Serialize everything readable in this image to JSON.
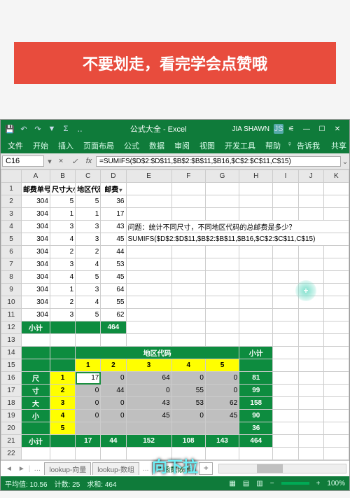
{
  "banner": "不要划走，看完学会点赞哦",
  "caption": "向下拉",
  "titlebar": {
    "title": "公式大全 - Excel",
    "user": "JIA SHAWN",
    "avatar": "JS"
  },
  "ribbon": {
    "tabs": [
      "文件",
      "开始",
      "插入",
      "页面布局",
      "公式",
      "数据",
      "审阅",
      "视图",
      "开发工具",
      "帮助"
    ],
    "tellme": "告诉我",
    "share": "共享"
  },
  "namebox": "C16",
  "formula": "=SUMIFS($D$2:$D$11,$B$2:$B$11,$B16,$C$2:$C$11,C$15)",
  "cols": [
    "",
    "A",
    "B",
    "C",
    "D",
    "E",
    "F",
    "G",
    "H",
    "I",
    "J",
    "K"
  ],
  "header_row": [
    "邮费单号",
    "尺寸大小",
    "地区代码",
    "邮费"
  ],
  "data_rows": [
    [
      "304",
      "5",
      "5",
      "36"
    ],
    [
      "304",
      "1",
      "1",
      "17"
    ],
    [
      "304",
      "3",
      "3",
      "43"
    ],
    [
      "304",
      "4",
      "3",
      "45"
    ],
    [
      "304",
      "2",
      "2",
      "44"
    ],
    [
      "304",
      "3",
      "4",
      "53"
    ],
    [
      "304",
      "4",
      "5",
      "45"
    ],
    [
      "304",
      "1",
      "3",
      "64"
    ],
    [
      "304",
      "2",
      "4",
      "55"
    ],
    [
      "304",
      "3",
      "5",
      "62"
    ]
  ],
  "subtotal_label": "小计",
  "subtotal_d": "464",
  "question": "问题：统计不同尺寸，不同地区代码的总邮费是多少？",
  "formula_text": "SUMIFS($D$2:$D$11,$B$2:$B$11,$B16,$C$2:$C$11,C$15)",
  "pivot": {
    "col_header": "地区代码",
    "subtotal": "小计",
    "row_header": [
      "尺",
      "寸",
      "大",
      "小"
    ],
    "cols": [
      "1",
      "2",
      "3",
      "4",
      "5"
    ],
    "rows": [
      "1",
      "2",
      "3",
      "4",
      "5"
    ],
    "vals": [
      [
        "17",
        "0",
        "64",
        "0",
        "0",
        "81"
      ],
      [
        "0",
        "44",
        "0",
        "55",
        "0",
        "99"
      ],
      [
        "0",
        "0",
        "43",
        "53",
        "62",
        "158"
      ],
      [
        "0",
        "0",
        "45",
        "0",
        "45",
        "90"
      ],
      [
        "",
        "",
        "",
        "",
        "",
        "36"
      ]
    ],
    "col_tot": [
      "17",
      "44",
      "152",
      "108",
      "143",
      "464"
    ]
  },
  "sheets": {
    "nav": [
      "◄",
      "►"
    ],
    "tabs": [
      "lookup-向量",
      "lookup-数组",
      "...",
      "IF函数嵌套"
    ],
    "active": 3
  },
  "status": {
    "left": "平均值: 10.56",
    "count": "计数: 25",
    "sum": "求和: 464",
    "zoom": "100%"
  }
}
